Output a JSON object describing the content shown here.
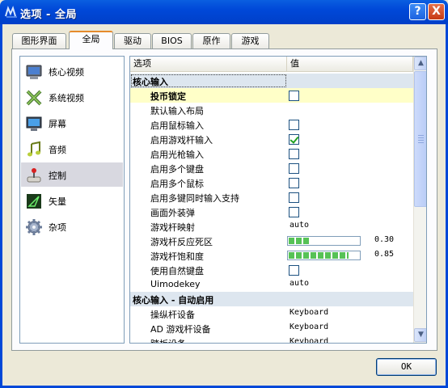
{
  "window": {
    "title": "选项 - 全局",
    "help_label": "?",
    "close_label": "X"
  },
  "tabs": [
    {
      "label": "图形界面"
    },
    {
      "label": "全局",
      "active": true
    },
    {
      "label": "驱动"
    },
    {
      "label": "BIOS"
    },
    {
      "label": "原作"
    },
    {
      "label": "游戏"
    }
  ],
  "categories": [
    {
      "label": "核心视频",
      "icon": "monitor-icon"
    },
    {
      "label": "系统视频",
      "icon": "x-icon"
    },
    {
      "label": "屏幕",
      "icon": "screen-icon"
    },
    {
      "label": "音频",
      "icon": "music-note-icon"
    },
    {
      "label": "控制",
      "icon": "joystick-icon",
      "selected": true
    },
    {
      "label": "矢量",
      "icon": "vector-icon"
    },
    {
      "label": "杂项",
      "icon": "gear-icon"
    }
  ],
  "grid": {
    "col_option": "选项",
    "col_value": "值",
    "rows": [
      {
        "type": "section",
        "label": "核心输入"
      },
      {
        "label": "投币锁定",
        "bold": true,
        "kind": "checkbox",
        "checked": false,
        "highlight": true
      },
      {
        "label": "默认输入布局",
        "kind": "none"
      },
      {
        "label": "启用鼠标输入",
        "kind": "checkbox",
        "checked": false
      },
      {
        "label": "启用游戏杆输入",
        "kind": "checkbox",
        "checked": true
      },
      {
        "label": "启用光枪输入",
        "kind": "checkbox",
        "checked": false
      },
      {
        "label": "启用多个键盘",
        "kind": "checkbox",
        "checked": false
      },
      {
        "label": "启用多个鼠标",
        "kind": "checkbox",
        "checked": false
      },
      {
        "label": "启用多键同时输入支持",
        "kind": "checkbox",
        "checked": false
      },
      {
        "label": "画面外装弹",
        "kind": "checkbox",
        "checked": false
      },
      {
        "label": "游戏杆映射",
        "kind": "text",
        "value": "auto"
      },
      {
        "label": "游戏杆反应死区",
        "kind": "slider",
        "value": "0.30",
        "level": 0.3
      },
      {
        "label": "游戏杆饱和度",
        "kind": "slider",
        "value": "0.85",
        "level": 0.85
      },
      {
        "label": "使用自然键盘",
        "kind": "checkbox",
        "checked": false
      },
      {
        "label": "Uimodekey",
        "kind": "text",
        "value": "auto"
      },
      {
        "type": "section",
        "label": "核心输入 - 自动启用"
      },
      {
        "label": "操纵杆设备",
        "kind": "text",
        "value": "Keyboard"
      },
      {
        "label": "AD 游戏杆设备",
        "kind": "text",
        "value": "Keyboard"
      },
      {
        "label": "踏板设备",
        "kind": "text",
        "value": "Keyboard"
      }
    ]
  },
  "scroll_up": "▲",
  "scroll_down": "▼",
  "ok_label": "OK"
}
